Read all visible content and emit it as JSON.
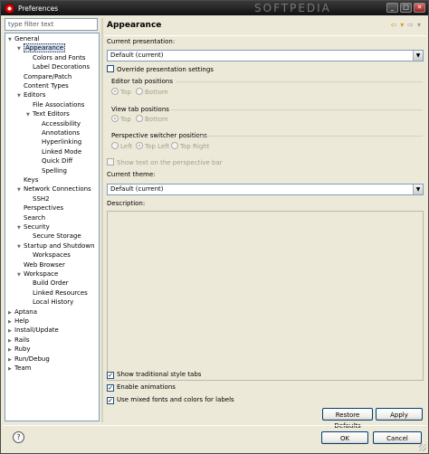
{
  "window": {
    "title": "Preferences",
    "watermark": "SOFTPEDIA"
  },
  "filter": {
    "placeholder": "type filter text"
  },
  "tree": [
    {
      "label": "General",
      "level": 0,
      "expander": "open"
    },
    {
      "label": "Appearance",
      "level": 1,
      "expander": "open",
      "selected": true
    },
    {
      "label": "Colors and Fonts",
      "level": 2,
      "expander": "none"
    },
    {
      "label": "Label Decorations",
      "level": 2,
      "expander": "none"
    },
    {
      "label": "Compare/Patch",
      "level": 1,
      "expander": "none"
    },
    {
      "label": "Content Types",
      "level": 1,
      "expander": "none"
    },
    {
      "label": "Editors",
      "level": 1,
      "expander": "open"
    },
    {
      "label": "File Associations",
      "level": 2,
      "expander": "none"
    },
    {
      "label": "Text Editors",
      "level": 2,
      "expander": "open"
    },
    {
      "label": "Accessibility",
      "level": 3,
      "expander": "none"
    },
    {
      "label": "Annotations",
      "level": 3,
      "expander": "none"
    },
    {
      "label": "Hyperlinking",
      "level": 3,
      "expander": "none"
    },
    {
      "label": "Linked Mode",
      "level": 3,
      "expander": "none"
    },
    {
      "label": "Quick Diff",
      "level": 3,
      "expander": "none"
    },
    {
      "label": "Spelling",
      "level": 3,
      "expander": "none"
    },
    {
      "label": "Keys",
      "level": 1,
      "expander": "none"
    },
    {
      "label": "Network Connections",
      "level": 1,
      "expander": "open"
    },
    {
      "label": "SSH2",
      "level": 2,
      "expander": "none"
    },
    {
      "label": "Perspectives",
      "level": 1,
      "expander": "none"
    },
    {
      "label": "Search",
      "level": 1,
      "expander": "none"
    },
    {
      "label": "Security",
      "level": 1,
      "expander": "open"
    },
    {
      "label": "Secure Storage",
      "level": 2,
      "expander": "none"
    },
    {
      "label": "Startup and Shutdown",
      "level": 1,
      "expander": "open"
    },
    {
      "label": "Workspaces",
      "level": 2,
      "expander": "none"
    },
    {
      "label": "Web Browser",
      "level": 1,
      "expander": "none"
    },
    {
      "label": "Workspace",
      "level": 1,
      "expander": "open"
    },
    {
      "label": "Build Order",
      "level": 2,
      "expander": "none"
    },
    {
      "label": "Linked Resources",
      "level": 2,
      "expander": "none"
    },
    {
      "label": "Local History",
      "level": 2,
      "expander": "none"
    },
    {
      "label": "Aptana",
      "level": 0,
      "expander": "closed"
    },
    {
      "label": "Help",
      "level": 0,
      "expander": "closed"
    },
    {
      "label": "Install/Update",
      "level": 0,
      "expander": "closed"
    },
    {
      "label": "Rails",
      "level": 0,
      "expander": "closed"
    },
    {
      "label": "Ruby",
      "level": 0,
      "expander": "closed"
    },
    {
      "label": "Run/Debug",
      "level": 0,
      "expander": "closed"
    },
    {
      "label": "Team",
      "level": 0,
      "expander": "closed"
    }
  ],
  "page": {
    "title": "Appearance",
    "current_presentation_label": "Current presentation:",
    "current_presentation_value": "Default (current)",
    "override_label": "Override presentation settings",
    "editor_tab_label": "Editor tab positions",
    "view_tab_label": "View tab positions",
    "top_label": "Top",
    "bottom_label": "Bottom",
    "perspective_switcher_label": "Perspective switcher positions",
    "left_label": "Left",
    "top_left_label": "Top Left",
    "top_right_label": "Top Right",
    "show_text_label": "Show text on the perspective bar",
    "current_theme_label": "Current theme:",
    "current_theme_value": "Default (current)",
    "description_label": "Description:",
    "show_traditional_label": "Show traditional style tabs",
    "enable_animations_label": "Enable animations",
    "mixed_fonts_label": "Use mixed fonts and colors for labels",
    "check_mark": "✓"
  },
  "buttons": {
    "restore_defaults": "Restore Defaults",
    "apply": "Apply",
    "ok": "OK",
    "cancel": "Cancel"
  },
  "icons": {
    "help": "?",
    "back": "⇦",
    "forward": "⇨",
    "dropdown": "▾",
    "expand_open": "▼",
    "expand_closed": "▶",
    "combo_arrow": "▼",
    "minimize": "_",
    "maximize": "□",
    "close": "✕"
  }
}
